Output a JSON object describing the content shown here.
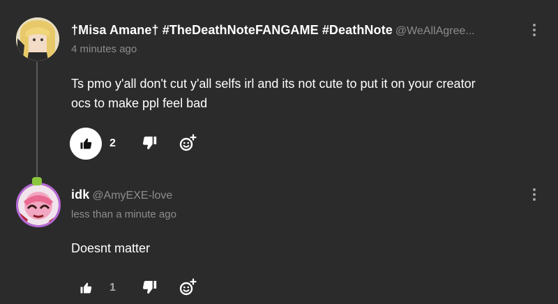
{
  "comments": [
    {
      "username": "†Misa Amane† #TheDeathNoteFANGAME #DeathNote",
      "handle": "@WeAllAgree...",
      "timestamp": "4 minutes ago",
      "body_line1": "Ts pmo y'all don't cut y'all selfs irl and its not cute to put it on your creator",
      "body_line2": "ocs to make ppl feel bad",
      "likes": "2",
      "liked": true,
      "icons": [
        "thumbs-up-icon",
        "thumbs-down-icon",
        "add-reaction-icon",
        "more-options-icon"
      ]
    },
    {
      "username": "idk",
      "handle": "@AmyEXE-love",
      "timestamp": "less than a minute ago",
      "body_line1": "Doesnt matter",
      "likes": "1",
      "liked": false,
      "icons": [
        "thumbs-up-icon",
        "thumbs-down-icon",
        "add-reaction-icon",
        "more-options-icon"
      ]
    }
  ],
  "colors": {
    "background": "#2b2b2b",
    "muted_text": "#8d8d8d",
    "text": "#ffffff",
    "thread_line": "#5a5a5a",
    "liked_button_bg": "#ffffff"
  }
}
